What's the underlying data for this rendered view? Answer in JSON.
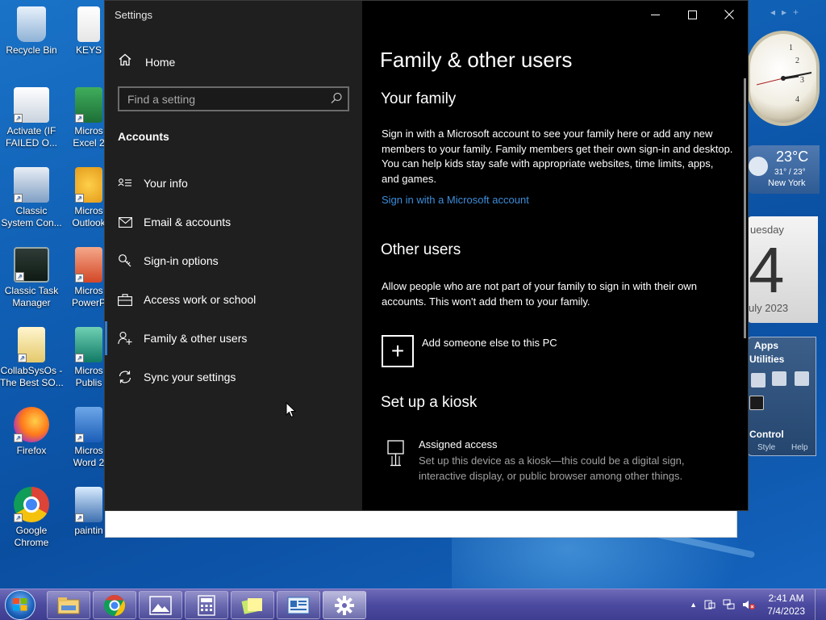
{
  "desktop": {
    "icons": [
      {
        "label1": "Recycle Bin",
        "label2": ""
      },
      {
        "label1": "Activate (IF",
        "label2": "FAILED O..."
      },
      {
        "label1": "Classic",
        "label2": "System Con..."
      },
      {
        "label1": "Classic Task",
        "label2": "Manager"
      },
      {
        "label1": "CollabSysOs -",
        "label2": "The Best SO..."
      },
      {
        "label1": "Firefox",
        "label2": ""
      },
      {
        "label1": "Google",
        "label2": "Chrome"
      },
      {
        "label1": "KEYS",
        "label2": ""
      },
      {
        "label1": "Micros",
        "label2": "Excel 2"
      },
      {
        "label1": "Micros",
        "label2": "Outlook"
      },
      {
        "label1": "Micros",
        "label2": "PowerP"
      },
      {
        "label1": "Micros",
        "label2": "Publis"
      },
      {
        "label1": "Micros",
        "label2": "Word 2"
      },
      {
        "label1": "paintin",
        "label2": ""
      }
    ]
  },
  "gadgets": {
    "weather": {
      "temp": "23°C",
      "range": "31° / 23°",
      "city": "New York"
    },
    "calendar": {
      "day": "uesday",
      "date": "4",
      "month": "uly 2023"
    },
    "apps": {
      "title": "Apps",
      "subtitle": "Utilities",
      "footer": "Control",
      "style": "Style",
      "help": "Help"
    }
  },
  "window": {
    "title": "Settings",
    "controls": {
      "minimize": "—",
      "maximize": "☐",
      "close": "✕"
    }
  },
  "sidebar": {
    "home_label": "Home",
    "search_placeholder": "Find a setting",
    "section": "Accounts",
    "items": [
      {
        "label": "Your info",
        "icon": "contact-card-icon"
      },
      {
        "label": "Email & accounts",
        "icon": "envelope-icon"
      },
      {
        "label": "Sign-in options",
        "icon": "key-icon"
      },
      {
        "label": "Access work or school",
        "icon": "briefcase-icon"
      },
      {
        "label": "Family & other users",
        "icon": "person-add-icon",
        "selected": true
      },
      {
        "label": "Sync your settings",
        "icon": "sync-icon"
      }
    ]
  },
  "main": {
    "title": "Family & other users",
    "family": {
      "heading": "Your family",
      "text": "Sign in with a Microsoft account to see your family here or add any new members to your family. Family members get their own sign-in and desktop. You can help kids stay safe with appropriate websites, time limits, apps, and games.",
      "link": "Sign in with a Microsoft account"
    },
    "other_users": {
      "heading": "Other users",
      "text": "Allow people who are not part of your family to sign in with their own accounts. This won't add them to your family.",
      "add_label": "Add someone else to this PC",
      "add_symbol": "+"
    },
    "kiosk": {
      "heading": "Set up a kiosk",
      "title": "Assigned access",
      "text": "Set up this device as a kiosk—this could be a digital sign, interactive display, or public browser among other things."
    }
  },
  "taskbar": {
    "time": "2:41 AM",
    "date": "7/4/2023",
    "tray_arrow": "▲"
  },
  "colors": {
    "accent": "#2b7cd3",
    "link": "#3d8ddb",
    "sidebar_bg": "#1f1f1f",
    "content_bg": "#000000"
  }
}
